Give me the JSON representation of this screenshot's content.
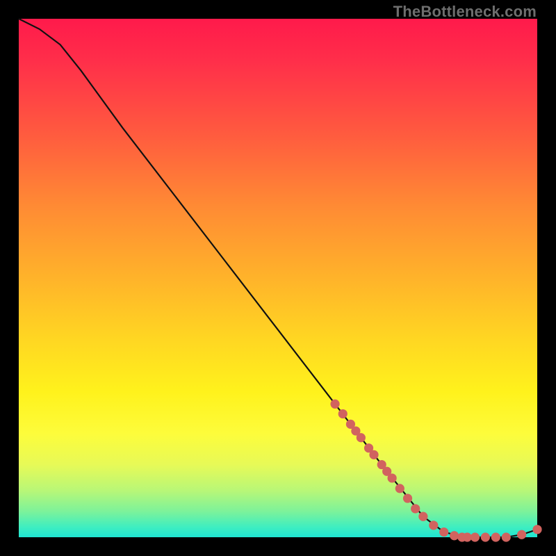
{
  "watermark": "TheBottleneck.com",
  "colors": {
    "background": "#000000",
    "curve_stroke": "#111111",
    "point_fill": "#d1635f",
    "point_stroke": "#c6554f"
  },
  "chart_data": {
    "type": "line",
    "title": "",
    "xlabel": "",
    "ylabel": "",
    "xlim": [
      0,
      100
    ],
    "ylim": [
      0,
      100
    ],
    "series": [
      {
        "name": "curve",
        "x": [
          0,
          4,
          8,
          12,
          20,
          30,
          40,
          50,
          60,
          70,
          78,
          82,
          86,
          90,
          94,
          97,
          100
        ],
        "y": [
          100,
          98,
          95,
          90,
          79,
          66,
          53,
          40,
          27,
          14,
          4,
          1,
          0,
          0,
          0,
          0.5,
          1.5
        ]
      }
    ],
    "scatter_points": {
      "name": "highlighted-points",
      "color": "#d1635f",
      "x": [
        61,
        62.5,
        64,
        65,
        66,
        67.5,
        68.5,
        70,
        71,
        72,
        73.5,
        75,
        76.5,
        78,
        80,
        82,
        84,
        85.5,
        86.5,
        88,
        90,
        92,
        94,
        97,
        100
      ],
      "y": [
        25.7,
        23.8,
        21.8,
        20.5,
        19.2,
        17.2,
        15.9,
        14.0,
        12.7,
        11.4,
        9.4,
        7.5,
        5.5,
        4.0,
        2.3,
        1.0,
        0.3,
        0,
        0,
        0,
        0,
        0,
        0,
        0.5,
        1.5
      ]
    }
  }
}
